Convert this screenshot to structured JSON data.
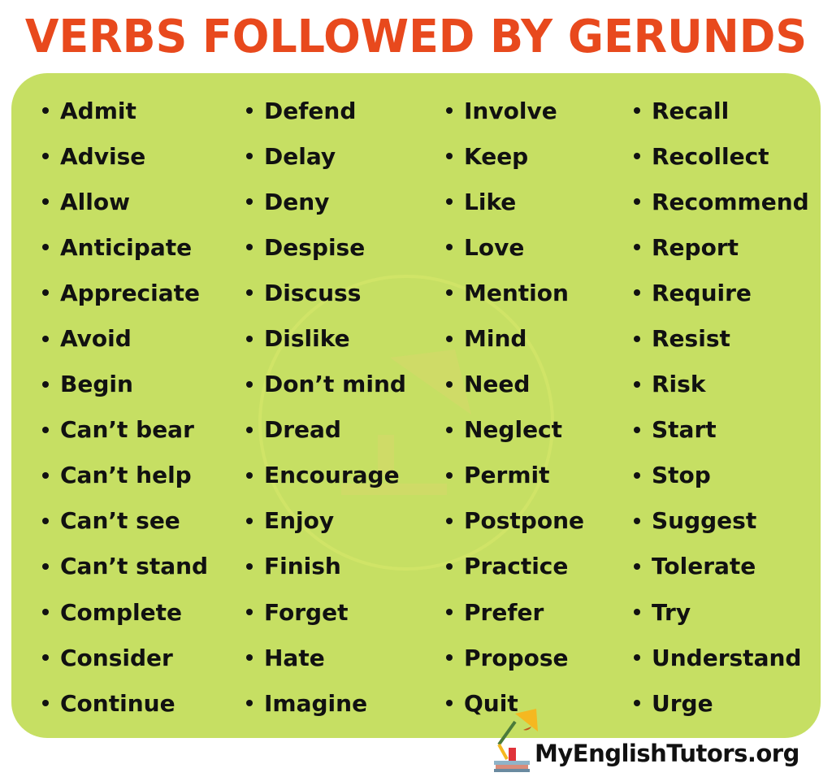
{
  "title": "VERBS FOLLOWED BY GERUNDS",
  "columns": [
    [
      "Admit",
      "Advise",
      "Allow",
      "Anticipate",
      "Appreciate",
      "Avoid",
      "Begin",
      "Can’t bear",
      "Can’t help",
      "Can’t see",
      "Can’t stand",
      "Complete",
      "Consider",
      "Continue"
    ],
    [
      "Defend",
      "Delay",
      "Deny",
      "Despise",
      "Discuss",
      "Dislike",
      "Don’t mind",
      "Dread",
      "Encourage",
      "Enjoy",
      "Finish",
      "Forget",
      "Hate",
      "Imagine"
    ],
    [
      "Involve",
      "Keep",
      "Like",
      "Love",
      "Mention",
      "Mind",
      "Need",
      "Neglect",
      "Permit",
      "Postpone",
      "Practice",
      "Prefer",
      "Propose",
      "Quit"
    ],
    [
      "Recall",
      "Recollect",
      "Recommend",
      "Report",
      "Require",
      "Resist",
      "Risk",
      "Start",
      "Stop",
      "Suggest",
      "Tolerate",
      "Try",
      "Understand",
      "Urge"
    ]
  ],
  "logo": {
    "text": "MyEnglishTutors.org"
  },
  "colors": {
    "title": "#e8491d",
    "panel": "#c6df63",
    "text": "#111111"
  }
}
